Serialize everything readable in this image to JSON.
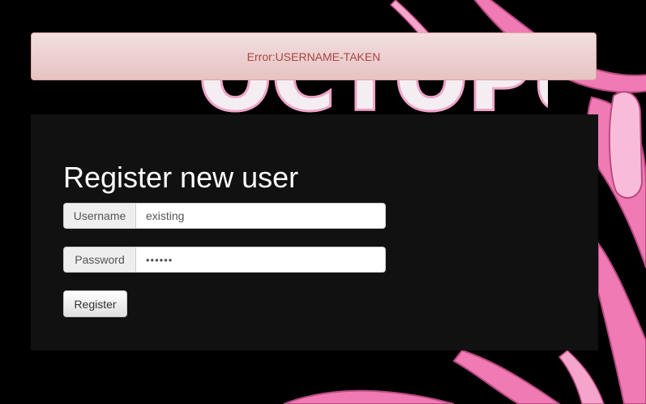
{
  "alert": {
    "message": "Error:USERNAME-TAKEN"
  },
  "logo": {
    "text": "OCTOPUS"
  },
  "form": {
    "title": "Register new user",
    "username": {
      "label": "Username",
      "value": "existing"
    },
    "password": {
      "label": "Password",
      "value": "••••••"
    },
    "submit_label": "Register"
  },
  "colors": {
    "page_background": "#000000",
    "panel_background": "#111111",
    "alert_background": "#f2dede",
    "alert_text": "#a94442",
    "tentacle_pink": "#f07ab4"
  }
}
